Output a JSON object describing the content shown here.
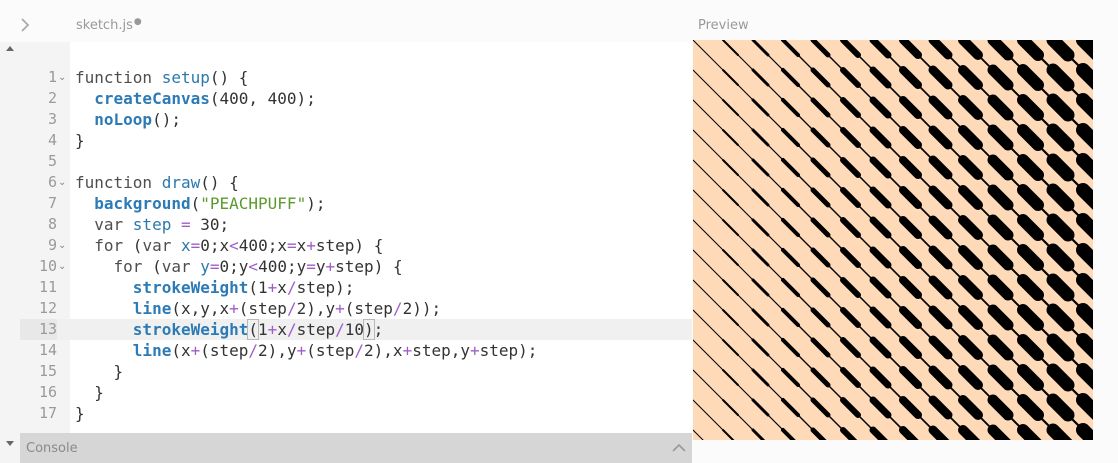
{
  "header": {
    "tab_name": "sketch.js",
    "unsaved_dot": "●",
    "preview_label": "Preview"
  },
  "editor": {
    "active_line": 13,
    "lines": [
      {
        "n": "1",
        "fold": "⌄"
      },
      {
        "n": "2"
      },
      {
        "n": "3"
      },
      {
        "n": "4"
      },
      {
        "n": "5"
      },
      {
        "n": "6",
        "fold": "⌄"
      },
      {
        "n": "7"
      },
      {
        "n": "8"
      },
      {
        "n": "9",
        "fold": "⌄"
      },
      {
        "n": "10",
        "fold": "⌄"
      },
      {
        "n": "11"
      },
      {
        "n": "12"
      },
      {
        "n": "13"
      },
      {
        "n": "14"
      },
      {
        "n": "15"
      },
      {
        "n": "16"
      },
      {
        "n": "17"
      }
    ],
    "code_lines": [
      [
        [
          "k",
          "function "
        ],
        [
          "d",
          "setup"
        ],
        [
          "",
          "() {"
        ]
      ],
      [
        [
          "",
          "  "
        ],
        [
          "f",
          "createCanvas"
        ],
        [
          "",
          "(400, 400);"
        ]
      ],
      [
        [
          "",
          "  "
        ],
        [
          "f",
          "noLoop"
        ],
        [
          "",
          "();"
        ]
      ],
      [
        [
          "",
          "}"
        ]
      ],
      [
        [
          "",
          ""
        ]
      ],
      [
        [
          "k",
          "function "
        ],
        [
          "d",
          "draw"
        ],
        [
          "",
          "() {"
        ]
      ],
      [
        [
          "",
          "  "
        ],
        [
          "f",
          "background"
        ],
        [
          "",
          "("
        ],
        [
          "s",
          "\"PEACHPUFF\""
        ],
        [
          "",
          ");"
        ]
      ],
      [
        [
          "",
          "  "
        ],
        [
          "k",
          "var "
        ],
        [
          "d",
          "step"
        ],
        [
          "o",
          " = "
        ],
        [
          "",
          "30;"
        ]
      ],
      [
        [
          "",
          "  "
        ],
        [
          "k",
          "for "
        ],
        [
          "",
          "("
        ],
        [
          "k",
          "var "
        ],
        [
          "d",
          "x"
        ],
        [
          "o",
          "="
        ],
        [
          "",
          "0;x"
        ],
        [
          "o",
          "<"
        ],
        [
          "",
          "400;x"
        ],
        [
          "o",
          "="
        ],
        [
          "",
          "x"
        ],
        [
          "o",
          "+"
        ],
        [
          "",
          "step) {"
        ]
      ],
      [
        [
          "",
          "    "
        ],
        [
          "k",
          "for "
        ],
        [
          "",
          "("
        ],
        [
          "k",
          "var "
        ],
        [
          "d",
          "y"
        ],
        [
          "o",
          "="
        ],
        [
          "",
          "0;y"
        ],
        [
          "o",
          "<"
        ],
        [
          "",
          "400;y"
        ],
        [
          "o",
          "="
        ],
        [
          "",
          "y"
        ],
        [
          "o",
          "+"
        ],
        [
          "",
          "step) {"
        ]
      ],
      [
        [
          "",
          "      "
        ],
        [
          "f",
          "strokeWeight"
        ],
        [
          "",
          "(1"
        ],
        [
          "o",
          "+"
        ],
        [
          "",
          "x"
        ],
        [
          "o",
          "/"
        ],
        [
          "",
          "step);"
        ]
      ],
      [
        [
          "",
          "      "
        ],
        [
          "f",
          "line"
        ],
        [
          "",
          "(x,y,x"
        ],
        [
          "o",
          "+"
        ],
        [
          "",
          "(step"
        ],
        [
          "o",
          "/"
        ],
        [
          "",
          "2),y"
        ],
        [
          "o",
          "+"
        ],
        [
          "",
          "(step"
        ],
        [
          "o",
          "/"
        ],
        [
          "",
          "2));"
        ]
      ],
      [
        [
          "",
          "      "
        ],
        [
          "f",
          "strokeWeight"
        ],
        [
          "bm",
          "("
        ],
        [
          "",
          "1"
        ],
        [
          "o",
          "+"
        ],
        [
          "",
          "x"
        ],
        [
          "o",
          "/"
        ],
        [
          "",
          "step"
        ],
        [
          "o",
          "/"
        ],
        [
          "",
          "10"
        ],
        [
          "bm",
          ")"
        ],
        [
          "",
          ";"
        ]
      ],
      [
        [
          "",
          "      "
        ],
        [
          "f",
          "line"
        ],
        [
          "",
          "(x"
        ],
        [
          "o",
          "+"
        ],
        [
          "",
          "(step"
        ],
        [
          "o",
          "/"
        ],
        [
          "",
          "2),y"
        ],
        [
          "o",
          "+"
        ],
        [
          "",
          "(step"
        ],
        [
          "o",
          "/"
        ],
        [
          "",
          "2),x"
        ],
        [
          "o",
          "+"
        ],
        [
          "",
          "step,y"
        ],
        [
          "o",
          "+"
        ],
        [
          "",
          "step);"
        ]
      ],
      [
        [
          "",
          "    }"
        ]
      ],
      [
        [
          "",
          "  }"
        ]
      ],
      [
        [
          "",
          "}"
        ]
      ]
    ]
  },
  "console": {
    "label": "Console"
  },
  "preview": {
    "background": "#ffdab9",
    "stroke": "#000000",
    "sketch": {
      "canvas": 400,
      "step": 30
    }
  },
  "colors": {
    "keyword": "#4e4e4e",
    "def": "#2a78ad",
    "func": "#2d7bb6",
    "string": "#5b9a2d",
    "operator": "#a05dc9"
  }
}
